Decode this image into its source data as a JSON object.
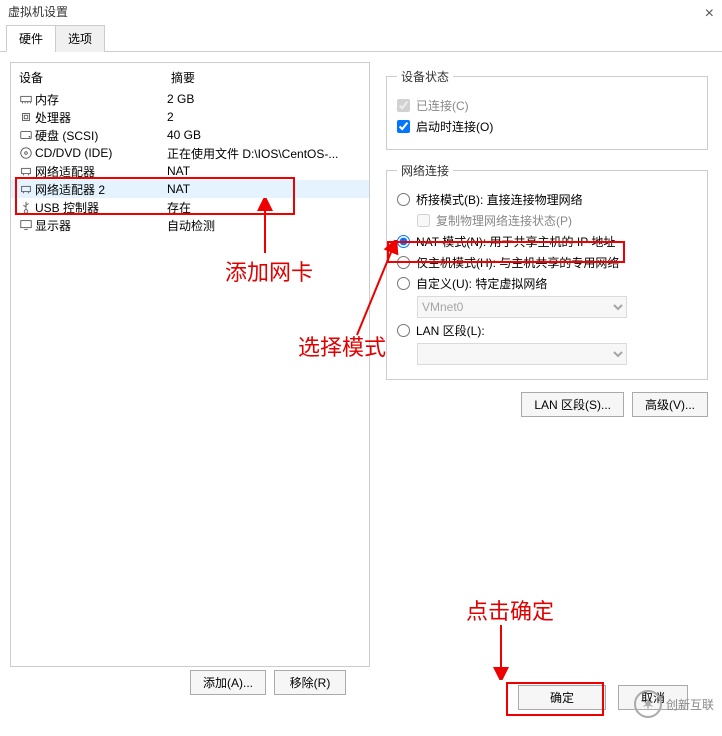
{
  "title": "虚拟机设置",
  "tabs": {
    "hw": "硬件",
    "opts": "选项"
  },
  "cols": {
    "device": "设备",
    "summary": "摘要"
  },
  "devices": [
    {
      "name": "内存",
      "summary": "2 GB",
      "icon": "memory"
    },
    {
      "name": "处理器",
      "summary": "2",
      "icon": "cpu"
    },
    {
      "name": "硬盘 (SCSI)",
      "summary": "40 GB",
      "icon": "hdd"
    },
    {
      "name": "CD/DVD (IDE)",
      "summary": "正在使用文件 D:\\IOS\\CentOS-...",
      "icon": "disc"
    },
    {
      "name": "网络适配器",
      "summary": "NAT",
      "icon": "net"
    },
    {
      "name": "网络适配器 2",
      "summary": "NAT",
      "icon": "net"
    },
    {
      "name": "USB 控制器",
      "summary": "存在",
      "icon": "usb"
    },
    {
      "name": "显示器",
      "summary": "自动检测",
      "icon": "display"
    }
  ],
  "deviceStatus": {
    "legend": "设备状态",
    "connected": "已连接(C)",
    "connectAtPower": "启动时连接(O)"
  },
  "netconn": {
    "legend": "网络连接",
    "bridged": "桥接模式(B): 直接连接物理网络",
    "replicate": "复制物理网络连接状态(P)",
    "nat": "NAT 模式(N): 用于共享主机的 IP 地址",
    "hostonly": "仅主机模式(H): 与主机共享的专用网络",
    "custom": "自定义(U): 特定虚拟网络",
    "vmnet": "VMnet0",
    "lanseg": "LAN 区段(L):"
  },
  "buttons": {
    "add": "添加(A)...",
    "remove": "移除(R)",
    "lanseg": "LAN 区段(S)...",
    "advanced": "高级(V)...",
    "ok": "确定",
    "cancel": "取消"
  },
  "annot": {
    "addnic": "添加网卡",
    "selmode": "选择模式",
    "clickok": "点击确定"
  },
  "watermark": "创新互联"
}
